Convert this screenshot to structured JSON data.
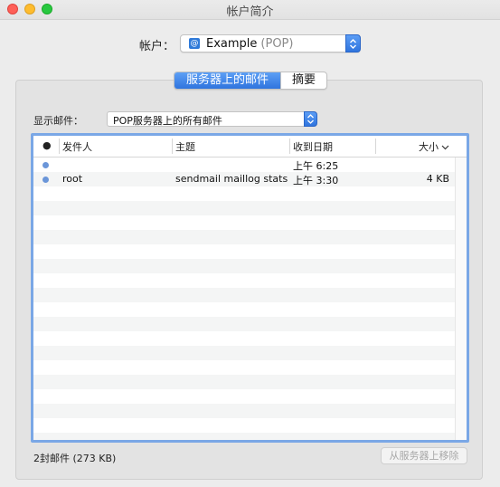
{
  "window": {
    "title": "帐户简介"
  },
  "account": {
    "label": "帐户：",
    "name": "Example",
    "type": "(POP)"
  },
  "tabs": [
    {
      "label": "服务器上的邮件",
      "active": true
    },
    {
      "label": "摘要",
      "active": false
    }
  ],
  "filter": {
    "label": "显示邮件：",
    "value": "POP服务器上的所有邮件"
  },
  "table": {
    "columns": {
      "status": "●",
      "sender": "发件人",
      "subject": "主题",
      "received": "收到日期",
      "size": "大小"
    },
    "rows": [
      {
        "sender": "",
        "subject": "",
        "received": "上午 6:25",
        "size": ""
      },
      {
        "sender": "root",
        "subject": "sendmail maillog stats",
        "received": "上午 3:30",
        "size": "4 KB"
      }
    ]
  },
  "footer": {
    "count": "2封邮件 (273 KB)",
    "remove_label": "从服务器上移除"
  },
  "colors": {
    "accent": "#2f74de",
    "status_dot": "#6b96d9"
  }
}
